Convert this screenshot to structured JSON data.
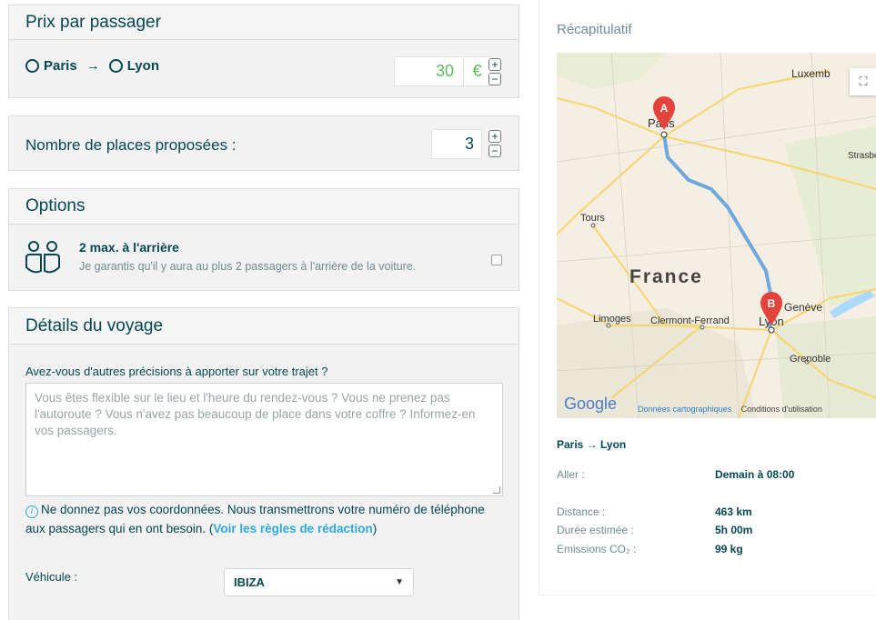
{
  "prix": {
    "title": "Prix par passager",
    "from": "Paris",
    "arrow": "→",
    "to": "Lyon",
    "price": "30",
    "currency": "€",
    "plus": "+",
    "minus": "−"
  },
  "places": {
    "label": "Nombre de places proposées :",
    "value": "3",
    "plus": "+",
    "minus": "−"
  },
  "options": {
    "title": "Options",
    "item_title": "2 max. à l'arrière",
    "item_desc": "Je garantis qu'il y aura au plus 2 passagers à l'arrière de la voiture.",
    "checked": false
  },
  "details": {
    "title": "Détails du voyage",
    "question": "Avez-vous d'autres précisions à apporter sur votre trajet ?",
    "placeholder": "Vous êtes flexible sur le lieu et l'heure du rendez-vous ? Vous ne prenez pas l'autoroute ? Vous n'avez pas beaucoup de place dans votre coffre ? Informez-en vos passagers.",
    "info_icon": "info-icon",
    "note": "Ne donnez pas vos coordonnées. Nous transmettrons votre numéro de téléphone aux passagers qui en ont besoin. (",
    "note_link": "Voir les règles de rédaction",
    "note_end": ")",
    "vehicle_label": "Véhicule :",
    "vehicle_value": "IBIZA"
  },
  "recap": {
    "title": "Récapitulatif",
    "map": {
      "labels": [
        "Paris",
        "Luxemb",
        "Strasbo",
        "Tours",
        "France",
        "Limoges",
        "Clermont-Ferrand",
        "Lyon",
        "Genève",
        "Grenoble"
      ],
      "marker_a": "A",
      "marker_b": "B",
      "logo": "Google",
      "footer_link": "Données cartographiques",
      "footer_text": "Conditions d'utilisation",
      "colors": {
        "route": "#5b9bd5",
        "marker": "#e2433a",
        "background": "#f4efe2"
      }
    },
    "route": "Paris → Lyon",
    "rows": [
      {
        "label": "Aller :",
        "value": "Demain à 08:00"
      },
      {
        "label": "Distance :",
        "value": "463 km"
      },
      {
        "label": "Durée estimée :",
        "value": "5h 00m"
      },
      {
        "label": "Emissions CO₂ :",
        "value": "99 kg"
      }
    ]
  }
}
